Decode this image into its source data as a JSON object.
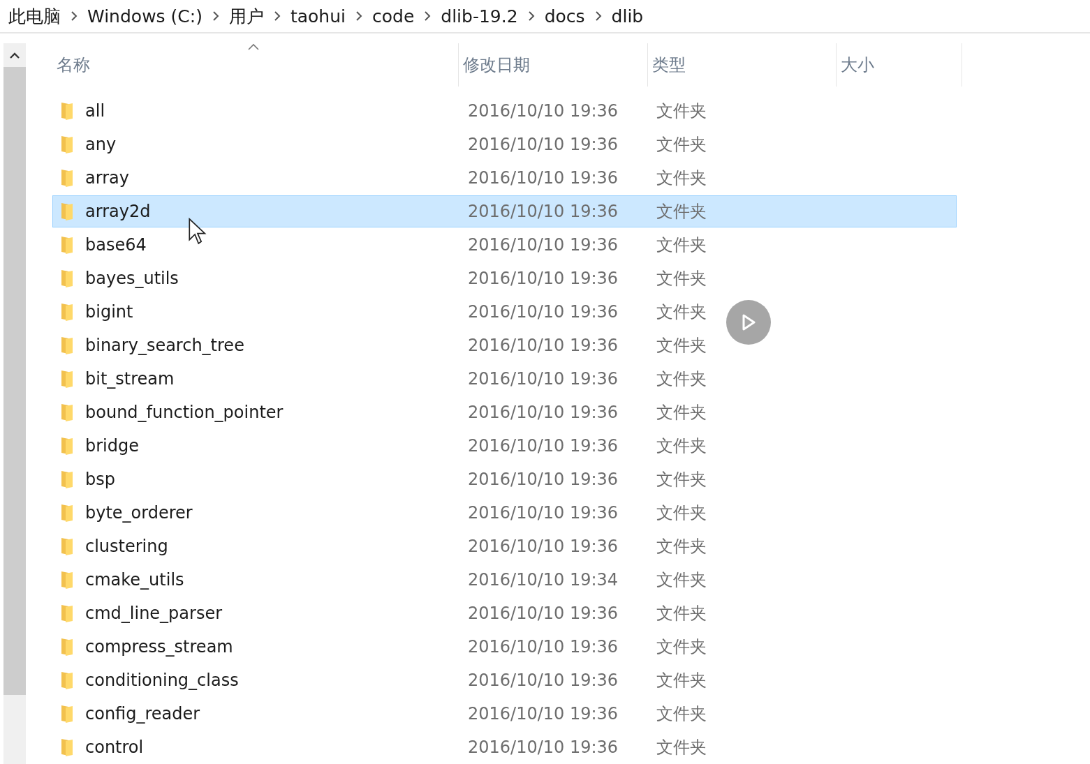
{
  "breadcrumb": [
    "此电脑",
    "Windows (C:)",
    "用户",
    "taohui",
    "code",
    "dlib-19.2",
    "docs",
    "dlib"
  ],
  "columns": [
    {
      "label": "名称",
      "sorted": true
    },
    {
      "label": "修改日期",
      "sorted": false
    },
    {
      "label": "类型",
      "sorted": false
    },
    {
      "label": "大小",
      "sorted": false
    }
  ],
  "rows": [
    {
      "name": "all",
      "modified": "2016/10/10 19:36",
      "type": "文件夹",
      "selected": false
    },
    {
      "name": "any",
      "modified": "2016/10/10 19:36",
      "type": "文件夹",
      "selected": false
    },
    {
      "name": "array",
      "modified": "2016/10/10 19:36",
      "type": "文件夹",
      "selected": false
    },
    {
      "name": "array2d",
      "modified": "2016/10/10 19:36",
      "type": "文件夹",
      "selected": true
    },
    {
      "name": "base64",
      "modified": "2016/10/10 19:36",
      "type": "文件夹",
      "selected": false
    },
    {
      "name": "bayes_utils",
      "modified": "2016/10/10 19:36",
      "type": "文件夹",
      "selected": false
    },
    {
      "name": "bigint",
      "modified": "2016/10/10 19:36",
      "type": "文件夹",
      "selected": false
    },
    {
      "name": "binary_search_tree",
      "modified": "2016/10/10 19:36",
      "type": "文件夹",
      "selected": false
    },
    {
      "name": "bit_stream",
      "modified": "2016/10/10 19:36",
      "type": "文件夹",
      "selected": false
    },
    {
      "name": "bound_function_pointer",
      "modified": "2016/10/10 19:36",
      "type": "文件夹",
      "selected": false
    },
    {
      "name": "bridge",
      "modified": "2016/10/10 19:36",
      "type": "文件夹",
      "selected": false
    },
    {
      "name": "bsp",
      "modified": "2016/10/10 19:36",
      "type": "文件夹",
      "selected": false
    },
    {
      "name": "byte_orderer",
      "modified": "2016/10/10 19:36",
      "type": "文件夹",
      "selected": false
    },
    {
      "name": "clustering",
      "modified": "2016/10/10 19:36",
      "type": "文件夹",
      "selected": false
    },
    {
      "name": "cmake_utils",
      "modified": "2016/10/10 19:34",
      "type": "文件夹",
      "selected": false
    },
    {
      "name": "cmd_line_parser",
      "modified": "2016/10/10 19:36",
      "type": "文件夹",
      "selected": false
    },
    {
      "name": "compress_stream",
      "modified": "2016/10/10 19:36",
      "type": "文件夹",
      "selected": false
    },
    {
      "name": "conditioning_class",
      "modified": "2016/10/10 19:36",
      "type": "文件夹",
      "selected": false
    },
    {
      "name": "config_reader",
      "modified": "2016/10/10 19:36",
      "type": "文件夹",
      "selected": false
    },
    {
      "name": "control",
      "modified": "2016/10/10 19:36",
      "type": "文件夹",
      "selected": false
    }
  ]
}
